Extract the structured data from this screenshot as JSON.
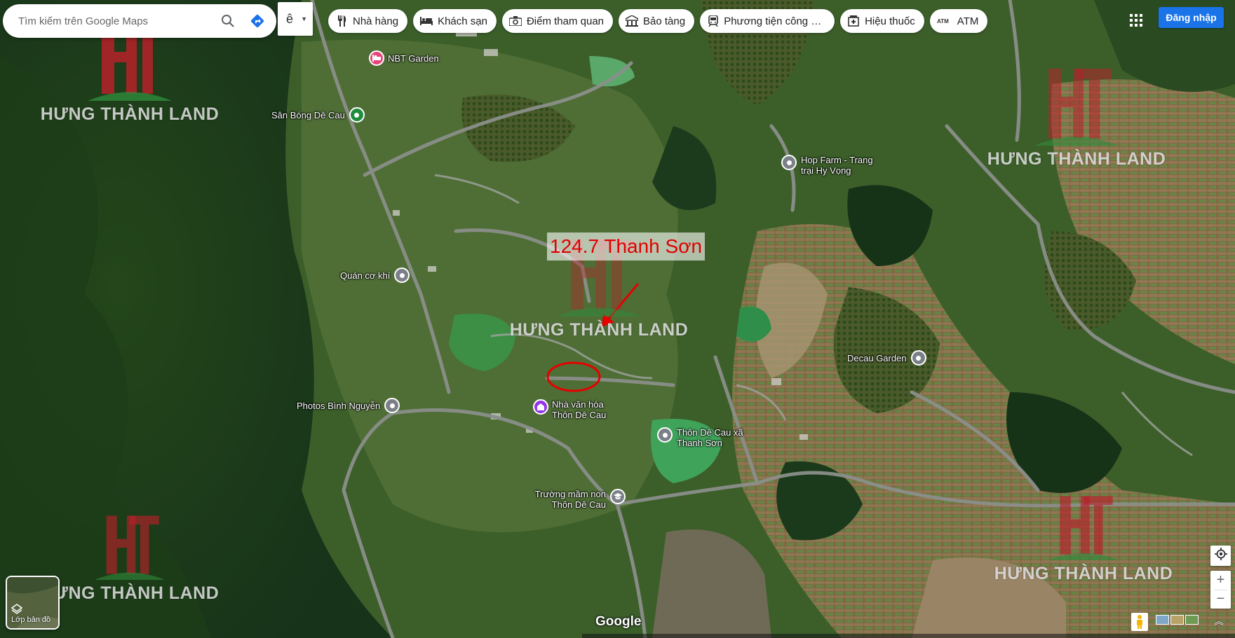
{
  "search": {
    "placeholder": "Tìm kiếm trên Google Maps"
  },
  "language_button": {
    "label": "ê"
  },
  "categories": [
    {
      "label": "Nhà hàng",
      "icon": "fork-knife-icon"
    },
    {
      "label": "Khách sạn",
      "icon": "bed-icon"
    },
    {
      "label": "Điểm tham quan",
      "icon": "camera-icon"
    },
    {
      "label": "Bảo tàng",
      "icon": "museum-icon"
    },
    {
      "label": "Phương tiện công cộ...",
      "icon": "transit-icon"
    },
    {
      "label": "Hiệu thuốc",
      "icon": "pharmacy-icon"
    },
    {
      "label": "ATM",
      "icon": "atm-icon"
    }
  ],
  "signin": {
    "label": "Đăng nhập"
  },
  "places": [
    {
      "name": "NBT Garden",
      "kind": "hotel",
      "color": "#e8457a"
    },
    {
      "name": "Sân Bóng Dê Cau",
      "kind": "sports",
      "color": "#1e8e3e"
    },
    {
      "name": "Hop Farm - Trang trại Hy Vọng",
      "kind": "generic",
      "color": "#7b8088"
    },
    {
      "name": "Quán cơ khí",
      "kind": "generic",
      "color": "#7b8088"
    },
    {
      "name": "Decau Garden",
      "kind": "generic",
      "color": "#7b8088"
    },
    {
      "name": "Photos Bình Nguyễn",
      "kind": "generic",
      "color": "#7b8088"
    },
    {
      "name": "Nhà văn hóa Thôn Dê Cau",
      "kind": "community",
      "color": "#9334e6"
    },
    {
      "name": "Thôn Dê Cau xã Thanh Sơn",
      "kind": "generic",
      "color": "#7b8088"
    },
    {
      "name": "Trường mầm non Thôn Dê Cau",
      "kind": "school",
      "color": "#7b8088"
    }
  ],
  "watermark": {
    "text": "HƯNG THÀNH LAND",
    "logo_color": "#b7212a",
    "accent_color": "#2e8b3c"
  },
  "annotation": {
    "text": "124.7 Thanh Sơn",
    "color": "#e00000"
  },
  "layers": {
    "label": "Lớp bản đồ"
  },
  "google_logo": "Google",
  "zoom": {
    "in": "+",
    "out": "−"
  }
}
